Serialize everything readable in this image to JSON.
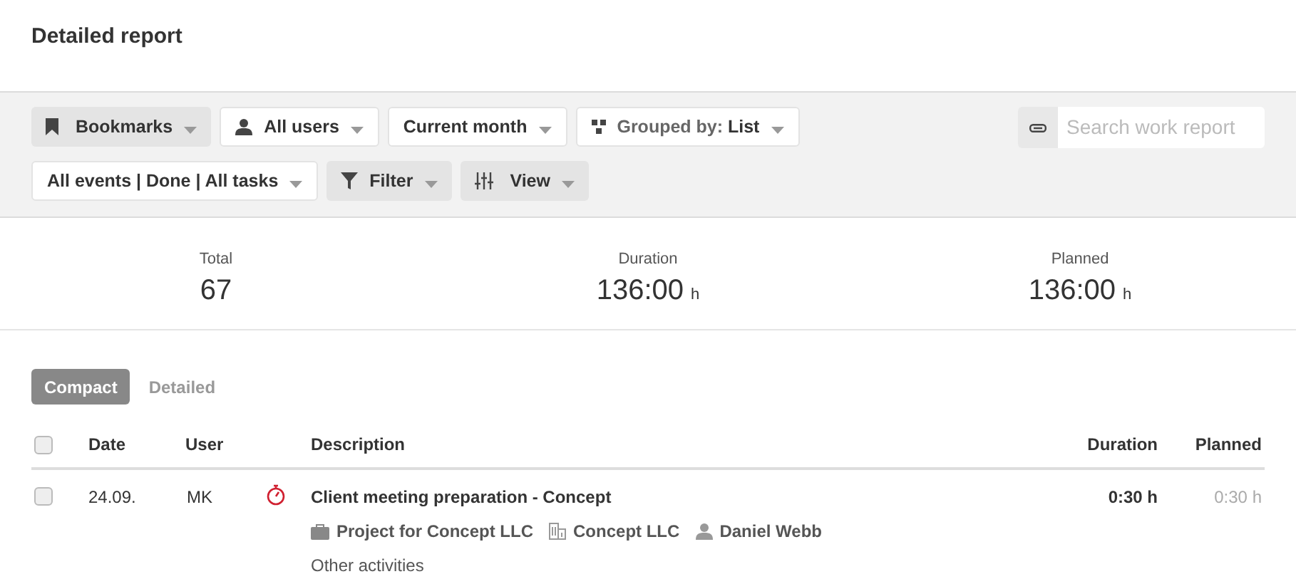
{
  "title": "Detailed report",
  "toolbar_rows": [
    [
      {
        "kind": "bookmark",
        "label": "Bookmarks"
      },
      {
        "kind": "user",
        "label": "All users"
      },
      {
        "kind": "plain",
        "label": "Current month"
      },
      {
        "kind": "group",
        "label": "Grouped by: **List**"
      }
    ],
    [
      {
        "kind": "plain",
        "label": "All events | Done | All tasks"
      },
      {
        "kind": "filter",
        "label": "Filter"
      },
      {
        "kind": "view",
        "label": "View"
      }
    ]
  ],
  "search": {
    "placeholder": "Search work report"
  },
  "stats": [
    {
      "label": "Total",
      "value": "67"
    },
    {
      "label": "Duration",
      "value": "136:00",
      "unit": "h"
    },
    {
      "label": "Planned",
      "value": "136:00",
      "unit": "h"
    }
  ],
  "view_tabs": [
    {
      "label": "Compact",
      "selected": true
    },
    {
      "label": "Detailed",
      "selected": false
    }
  ],
  "table": {
    "columns": [
      "Date",
      "User",
      "Description",
      "Duration",
      "Planned"
    ],
    "header_checked": false,
    "rows": [
      {
        "checked": false,
        "date": "24.09.",
        "user": "MK",
        "title": "Client meeting preparation - Concept",
        "project": "Project for Concept LLC",
        "company": "Concept LLC",
        "person": "Daniel Webb",
        "activity": "Other activities",
        "duration": "0:30 h",
        "planned": "0:30 h"
      }
    ]
  }
}
